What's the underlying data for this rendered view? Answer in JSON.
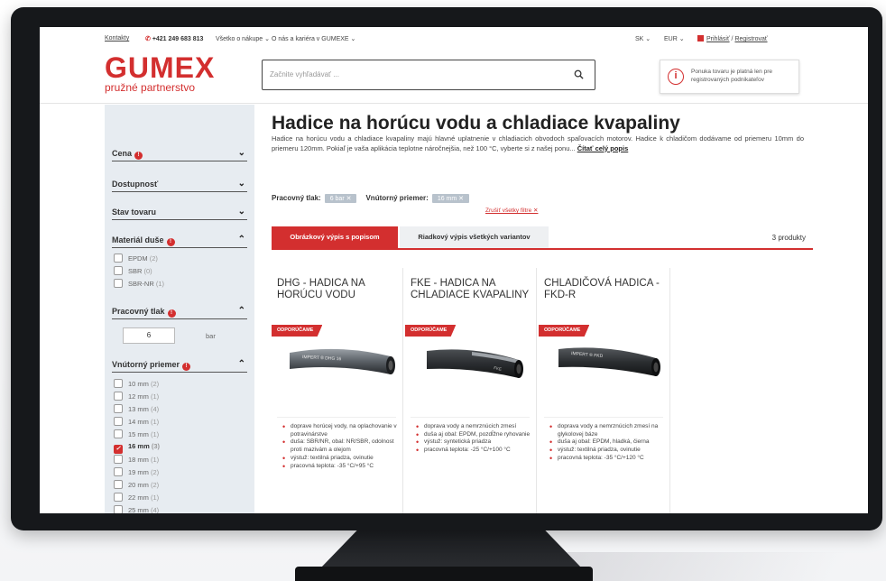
{
  "topbar": {
    "kontakty": "Kontakty",
    "phone": "+421 249 683 813",
    "menu1": "Všetko o nákupe ⌄",
    "menu2": "O nás a kariéra v GUMEXE ⌄",
    "lang": "SK ⌄",
    "currency": "EUR ⌄",
    "login": "Prihlásiť",
    "slash": "/",
    "register": "Registrovať"
  },
  "header": {
    "logo_main": "GUMEX",
    "logo_sub": "pružné partnerstvo",
    "search_placeholder": "Začnite vyhľadávať ...",
    "notice": "Ponuka tovaru je platná len pre registrovaných podnikateľov"
  },
  "filters": {
    "price": "Cena",
    "availability": "Dostupnosť",
    "condition": "Stav tovaru",
    "material": "Materiál duše",
    "material_options": [
      {
        "label": "EPDM",
        "count": "(2)"
      },
      {
        "label": "SBR",
        "count": "(0)"
      },
      {
        "label": "SBR-NR",
        "count": "(1)"
      }
    ],
    "pressure": "Pracovný tlak",
    "pressure_value": "6",
    "pressure_unit": "bar",
    "diameter": "Vnútorný priemer",
    "diameter_options": [
      {
        "label": "10 mm",
        "count": "(2)",
        "checked": false
      },
      {
        "label": "12 mm",
        "count": "(1)",
        "checked": false
      },
      {
        "label": "13 mm",
        "count": "(4)",
        "checked": false
      },
      {
        "label": "14 mm",
        "count": "(1)",
        "checked": false
      },
      {
        "label": "15 mm",
        "count": "(1)",
        "checked": false
      },
      {
        "label": "16 mm",
        "count": "(3)",
        "checked": true
      },
      {
        "label": "18 mm",
        "count": "(1)",
        "checked": false
      },
      {
        "label": "19 mm",
        "count": "(2)",
        "checked": false
      },
      {
        "label": "20 mm",
        "count": "(2)",
        "checked": false
      },
      {
        "label": "22 mm",
        "count": "(1)",
        "checked": false
      },
      {
        "label": "25 mm",
        "count": "(4)",
        "checked": false
      }
    ]
  },
  "main": {
    "title": "Hadice na horúcu vodu a chladiace kvapaliny",
    "description": "Hadice na horúcu vodu a chladiace kvapaliny majú hlavné uplatnenie v chladiacich obvodoch spaľovacích motorov. Hadice k chladičom dodávame od priemeru 10mm do priemeru 120mm. Pokiaľ je vaša aplikácia teplotne náročnejšia, než 100 °C, vyberte si z našej ponu...",
    "read_more": "Čítať celý popis",
    "chip_pressure_label": "Pracovný tlak:",
    "chip_pressure_value": "6 bar ✕",
    "chip_diameter_label": "Vnútorný priemer:",
    "chip_diameter_value": "16 mm ✕",
    "clear_filters": "Zrušiť všetky filtre ✕",
    "tab1": "Obrázkový výpis s popisom",
    "tab2": "Riadkový výpis všetkých variantov",
    "count": "3 produkty"
  },
  "products": [
    {
      "title": "DHG - HADICA NA HORÚCU VODU",
      "badge": "ODPORÚČAME",
      "hose_text": "IMPERT ® DHG 16",
      "bullets": [
        "doprave horúcej vody, na oplachovanie v potravinárstve",
        "duša: SBR/NR, obal: NR/SBR, odolnost proti mazivám a olejom",
        "výstuž: textilná priadza, ovinutie",
        "pracovná teplota: -35 °C/+95 °C"
      ]
    },
    {
      "title": "FKE - HADICA NA CHLADIACE KVAPALINY",
      "badge": "ODPORÚČAME",
      "hose_text": "FKE",
      "bullets": [
        "doprava vody a nemrznúcich zmesí",
        "duša aj obal: EPDM, pozdĺžne ryhovanie",
        "výstuž: syntetická priadza",
        "pracovná teplota: -25 °C/+100 °C"
      ]
    },
    {
      "title": "CHLADIČOVÁ HADICA - FKD-R",
      "badge": "ODPORÚČAME",
      "hose_text": "IMPERT ® FKD",
      "bullets": [
        "doprava vody a nemrznúcich zmesí na glykolovej báze",
        "duša aj obal: EPDM, hladká, čierna",
        "výstuž: textilná priadza, ovinutie",
        "pracovná teplota: -35 °C/+120 °C"
      ]
    }
  ],
  "colors": {
    "accent": "#d32f2f",
    "sidebar": "#e7ecf1",
    "bezel": "#16181b"
  }
}
